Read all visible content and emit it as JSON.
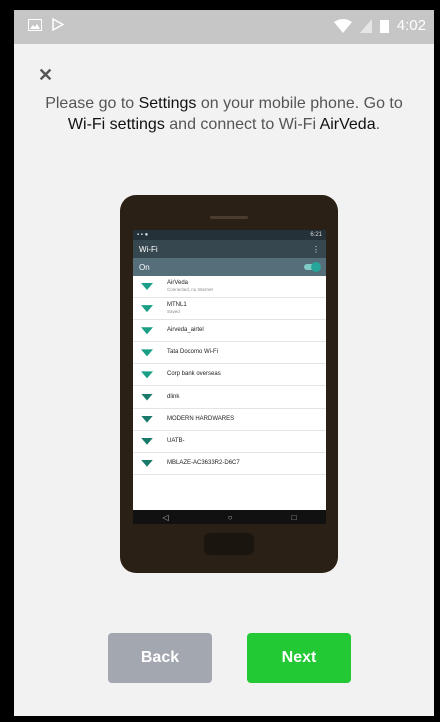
{
  "status_bar": {
    "time": "4:02",
    "left_icons": [
      "image-icon",
      "play-store-icon"
    ],
    "right_icons": [
      "wifi-icon",
      "no-sim-icon",
      "battery-icon"
    ]
  },
  "close_label": "✕",
  "instruction": {
    "part1": "Please go to ",
    "settings": "Settings",
    "part2": " on your mobile phone. Go to ",
    "wifi_settings": "Wi-Fi settings",
    "part3": " and connect to Wi-Fi ",
    "network": "AirVeda",
    "part4": "."
  },
  "phone_screen": {
    "status_time": "6:21",
    "title": "Wi-Fi",
    "menu": "⋮",
    "on_label": "On",
    "networks": [
      {
        "name": "AirVeda",
        "sub": "Connected, no Internet"
      },
      {
        "name": "MTNL1",
        "sub": "Saved"
      },
      {
        "name": "Airveda_airtel",
        "sub": ""
      },
      {
        "name": "Tata Docomo Wi-Fi",
        "sub": ""
      },
      {
        "name": "Corp bank overseas",
        "sub": ""
      },
      {
        "name": "dlink",
        "sub": ""
      },
      {
        "name": "MODERN HARDWARES",
        "sub": ""
      },
      {
        "name": "UATB-",
        "sub": ""
      },
      {
        "name": "MBLAZE-AC3633R2-D6C7",
        "sub": ""
      }
    ],
    "nav": [
      "◁",
      "○",
      "□"
    ]
  },
  "buttons": {
    "back": "Back",
    "next": "Next"
  },
  "colors": {
    "back_button": "#a3a7b0",
    "next_button": "#22c934",
    "status_bar": "#c6c6c6"
  }
}
